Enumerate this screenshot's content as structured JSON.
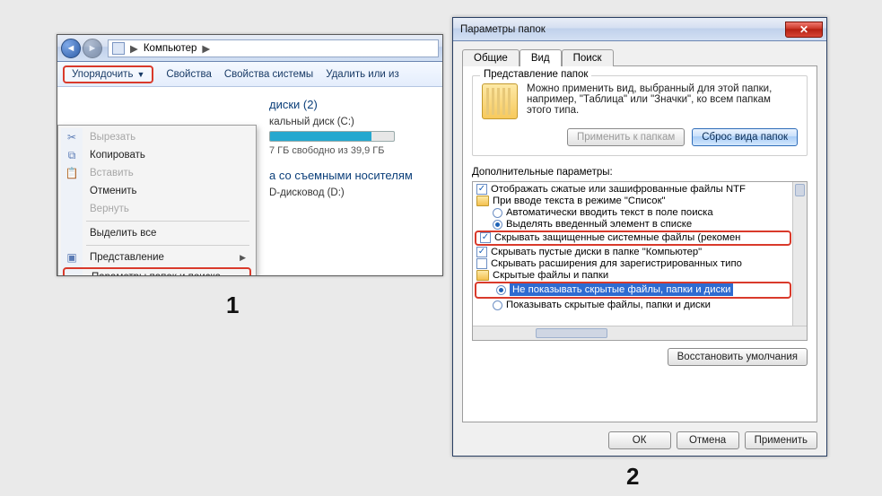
{
  "labels": {
    "one": "1",
    "two": "2"
  },
  "explorer": {
    "breadcrumb_root": "Компьютер",
    "breadcrumb_arrow": "▶",
    "toolbar": {
      "organize": "Упорядочить",
      "properties": "Свойства",
      "sysprops": "Свойства системы",
      "remove": "Удалить или из"
    },
    "content": {
      "disks_head": "диски (2)",
      "local_disk": "кальный диск (C:)",
      "free_text": "7 ГБ свободно из 39,9 ГБ",
      "removable_head": "а со съемными носителям",
      "dvd": "D-дисковод (D:)"
    },
    "menu": {
      "cut": "Вырезать",
      "copy": "Копировать",
      "paste": "Вставить",
      "undo": "Отменить",
      "redo": "Вернуть",
      "selectall": "Выделить все",
      "layout": "Представление",
      "options": "Параметры папок и поиска"
    }
  },
  "dialog": {
    "title": "Параметры папок",
    "tabs": {
      "general": "Общие",
      "view": "Вид",
      "search": "Поиск"
    },
    "group": {
      "legend": "Представление папок",
      "text": "Можно применить вид, выбранный для этой папки, например, \"Таблица\" или \"Значки\", ко всем папкам этого типа.",
      "apply": "Применить к папкам",
      "reset": "Сброс вида папок"
    },
    "adv_label": "Дополнительные параметры:",
    "adv": {
      "i0": "Отображать сжатые или зашифрованные файлы NTF",
      "i1": "При вводе текста в режиме \"Список\"",
      "i2": "Автоматически вводить текст в поле поиска",
      "i3": "Выделять введенный элемент в списке",
      "i4": "Скрывать защищенные системные файлы (рекомен",
      "i5": "Скрывать пустые диски в папке \"Компьютер\"",
      "i6": "Скрывать расширения для зарегистрированных типо",
      "i7": "Скрытые файлы и папки",
      "i8": "Не показывать скрытые файлы, папки и диски",
      "i9": "Показывать скрытые файлы, папки и диски"
    },
    "restore": "Восстановить умолчания",
    "buttons": {
      "ok": "ОК",
      "cancel": "Отмена",
      "apply": "Применить"
    }
  }
}
